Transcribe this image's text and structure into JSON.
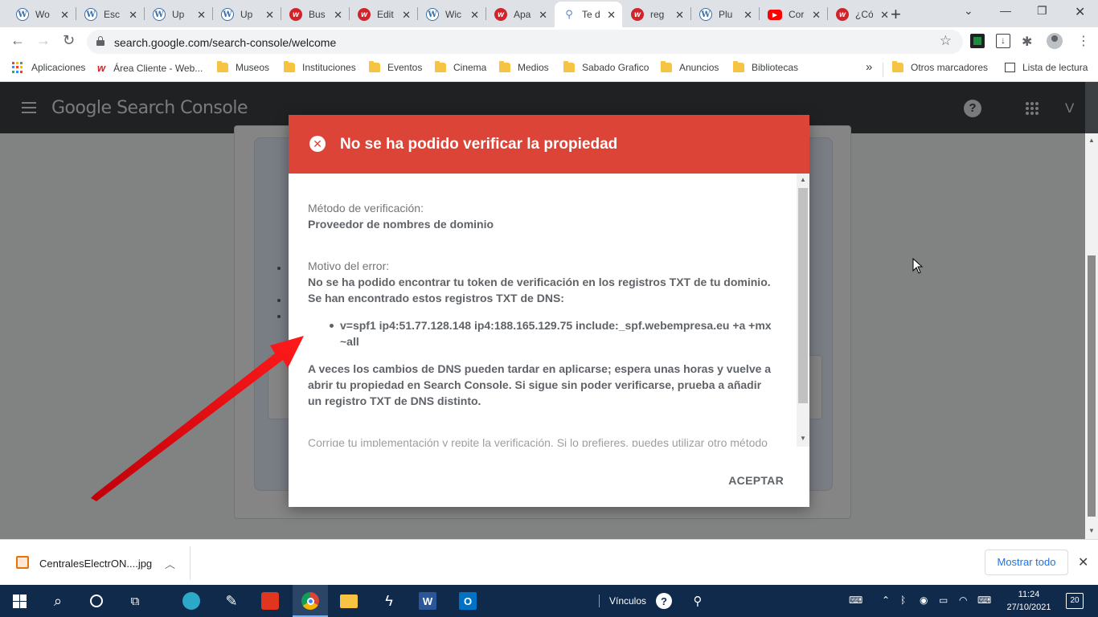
{
  "browser": {
    "tabs": [
      {
        "label": "Wo",
        "icon": "wordpress-icon"
      },
      {
        "label": "Esc",
        "icon": "wordpress-icon"
      },
      {
        "label": "Up",
        "icon": "wordpress-icon"
      },
      {
        "label": "Up",
        "icon": "wordpress-icon"
      },
      {
        "label": "Bus",
        "icon": "webempresa-icon"
      },
      {
        "label": "Edit",
        "icon": "webempresa-icon"
      },
      {
        "label": "Wic",
        "icon": "wordpress-icon"
      },
      {
        "label": "Apa",
        "icon": "webempresa-icon"
      },
      {
        "label": "Te d",
        "icon": "search-console-icon",
        "active": true
      },
      {
        "label": "reg",
        "icon": "webempresa-icon"
      },
      {
        "label": "Plu",
        "icon": "wordpress-icon"
      },
      {
        "label": "Cor",
        "icon": "youtube-icon"
      },
      {
        "label": "¿Có",
        "icon": "webempresa-icon"
      }
    ],
    "url": "search.google.com/search-console/welcome",
    "bookmarks": [
      {
        "label": "Aplicaciones",
        "icon": "apps-grid-icon"
      },
      {
        "label": "Área Cliente - Web...",
        "icon": "webempresa-icon"
      },
      {
        "label": "Museos",
        "icon": "folder-icon"
      },
      {
        "label": "Instituciones",
        "icon": "folder-icon"
      },
      {
        "label": "Eventos",
        "icon": "folder-icon"
      },
      {
        "label": "Cinema",
        "icon": "folder-icon"
      },
      {
        "label": "Medios",
        "icon": "folder-icon"
      },
      {
        "label": "Sabado Grafico",
        "icon": "folder-icon"
      },
      {
        "label": "Anuncios",
        "icon": "folder-icon"
      },
      {
        "label": "Bibliotecas",
        "icon": "folder-icon"
      }
    ],
    "bookmarks_more": "»",
    "other_bookmarks": "Otros marcadores",
    "reading_list": "Lista de lectura"
  },
  "app": {
    "title": "Google Search Console",
    "account_initial": "V"
  },
  "dialog": {
    "title": "No se ha podido verificar la propiedad",
    "method_label": "Método de verificación:",
    "method_value": "Proveedor de nombres de dominio",
    "error_label": "Motivo del error:",
    "error_line1": "No se ha podido encontrar tu token de verificación en los registros TXT de tu dominio.",
    "error_line2": "Se han encontrado estos registros TXT de DNS:",
    "txt_record": "v=spf1 ip4:51.77.128.148 ip4:188.165.129.75 include:_spf.webempresa.eu +a +mx ~all",
    "dns_note": "A veces los cambios de DNS pueden tardar en aplicarse; espera unas horas y vuelve a abrir tu propiedad en Search Console. Si sigue sin poder verificarse, prueba a añadir un registro TXT de DNS distinto.",
    "fix_note": "Corrige tu implementación y repite la verificación. Si lo prefieres, puedes utilizar otro método",
    "accept_label": "ACEPTAR",
    "header_color": "#db4437"
  },
  "download_bar": {
    "filename": "CentralesElectrON....jpg",
    "show_all_label": "Mostrar todo"
  },
  "taskbar": {
    "links_label": "Vínculos",
    "time": "11:24",
    "date": "27/10/2021",
    "notifications": "20"
  }
}
